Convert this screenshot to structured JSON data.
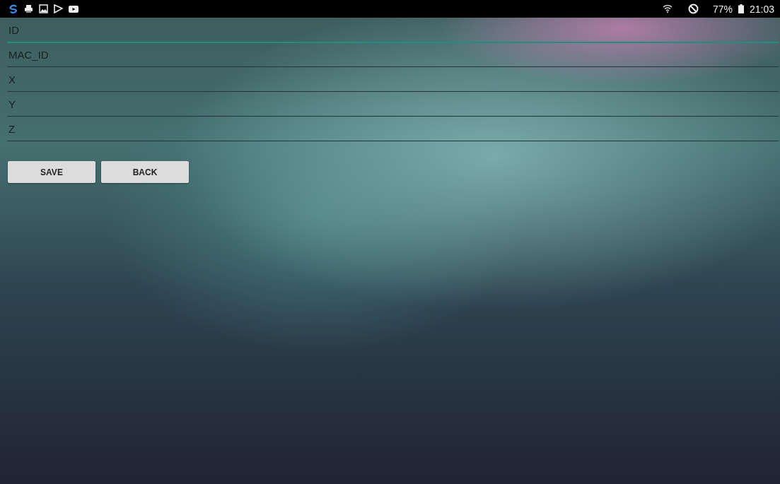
{
  "status_bar": {
    "battery": "77%",
    "time": "21:03"
  },
  "fields": [
    {
      "placeholder": "ID",
      "focused": true
    },
    {
      "placeholder": "MAC_ID",
      "focused": false
    },
    {
      "placeholder": "X",
      "focused": false
    },
    {
      "placeholder": "Y",
      "focused": false
    },
    {
      "placeholder": "Z",
      "focused": false
    }
  ],
  "buttons": [
    "SAVE",
    "BACK"
  ]
}
